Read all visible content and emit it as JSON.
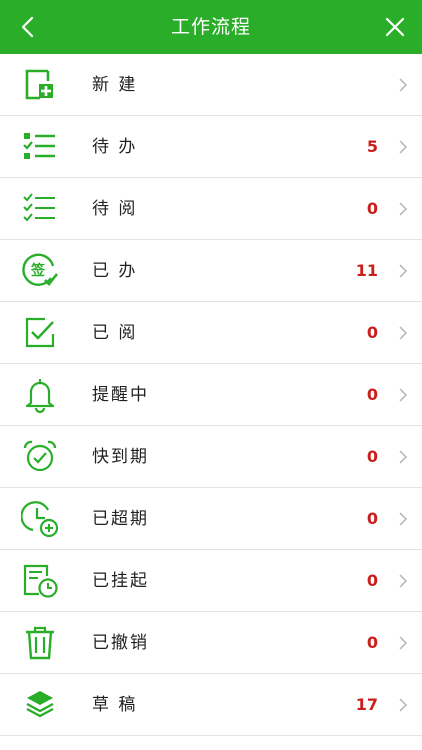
{
  "header": {
    "title": "工作流程"
  },
  "colors": {
    "brand": "#2aae2a",
    "count": "#c9201d",
    "icon": "#2aae2a"
  },
  "menu": [
    {
      "label": "新 建",
      "count": "",
      "icon": "new-doc-icon"
    },
    {
      "label": "待 办",
      "count": "5",
      "icon": "todo-list-icon"
    },
    {
      "label": "待 阅",
      "count": "0",
      "icon": "to-read-list-icon"
    },
    {
      "label": "已 办",
      "count": "11",
      "icon": "signed-icon"
    },
    {
      "label": "已 阅",
      "count": "0",
      "icon": "checked-box-icon"
    },
    {
      "label": "提醒中",
      "count": "0",
      "icon": "bell-icon"
    },
    {
      "label": "快到期",
      "count": "0",
      "icon": "alarm-clock-icon"
    },
    {
      "label": "已超期",
      "count": "0",
      "icon": "clock-overdue-icon"
    },
    {
      "label": "已挂起",
      "count": "0",
      "icon": "suspended-doc-icon"
    },
    {
      "label": "已撤销",
      "count": "0",
      "icon": "trash-icon"
    },
    {
      "label": "草 稿",
      "count": "17",
      "icon": "layers-icon"
    }
  ]
}
